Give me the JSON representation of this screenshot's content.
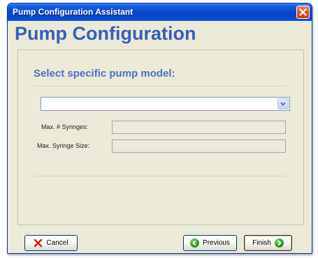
{
  "window": {
    "title": "Pump Configuration Assistant"
  },
  "header": {
    "title": "Pump Configuration"
  },
  "form": {
    "subtitle": "Select specific pump model:",
    "pump_model_value": "",
    "max_syringes_label": "Max. # Syringes:",
    "max_syringes_value": "",
    "max_syringe_size_label": "Max. Syringe Size:",
    "max_syringe_size_value": ""
  },
  "buttons": {
    "cancel": "Cancel",
    "previous": "Previous",
    "finish": "Finish"
  },
  "colors": {
    "titlebar": "#0a4ccf",
    "header_title": "#3560b8",
    "subtitle": "#4a73c4",
    "window_bg": "#ece9d8",
    "close_button": "#d9542c",
    "cancel_icon": "#d11d1d",
    "nav_icon": "#2a9a26"
  },
  "icons": {
    "close": "close-icon",
    "dropdown": "chevron-down-icon",
    "cancel": "x-icon",
    "previous": "arrow-left-icon",
    "finish": "arrow-right-icon"
  }
}
